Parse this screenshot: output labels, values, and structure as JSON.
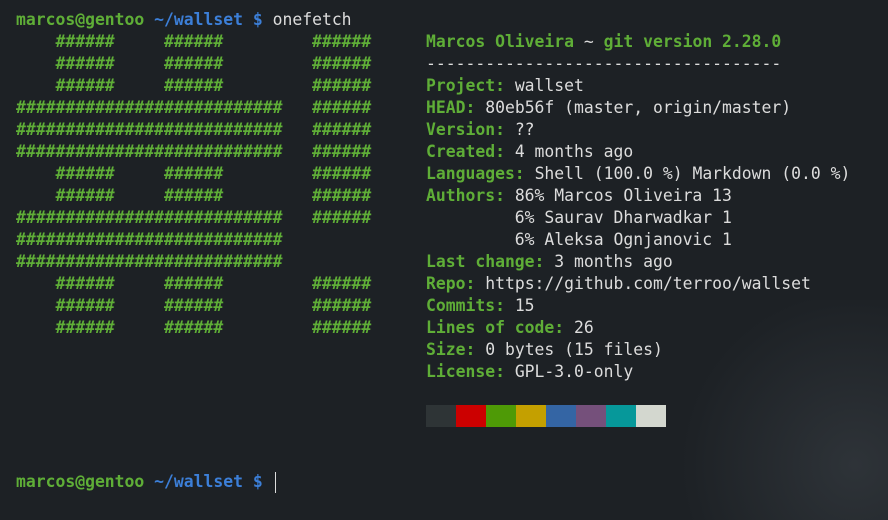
{
  "prompt": {
    "user_host": "marcos@gentoo",
    "path": "~/wallset",
    "symbol": "$"
  },
  "command": "onefetch",
  "ascii_art": [
    "    ######     ######         ######",
    "    ######     ######         ######",
    "    ######     ######         ######",
    "###########################   ######",
    "###########################   ######",
    "###########################   ######",
    "    ######     ######         ######",
    "    ######     ######         ######",
    "###########################   ######",
    "###########################",
    "###########################",
    "    ######     ######         ######",
    "    ######     ######         ######",
    "    ######     ######         ######"
  ],
  "header": {
    "name": "Marcos Oliveira",
    "tilde": " ~ ",
    "git": "git version 2.28.0"
  },
  "separator": "------------------------------------",
  "info": [
    {
      "key": "Project: ",
      "value": "wallset"
    },
    {
      "key": "HEAD: ",
      "value": "80eb56f (master, origin/master)"
    },
    {
      "key": "Version: ",
      "value": "??"
    },
    {
      "key": "Created: ",
      "value": "4 months ago"
    },
    {
      "key": "Languages: ",
      "value": "Shell (100.0 %) Markdown (0.0 %)"
    },
    {
      "key": "Authors: ",
      "value": "86% Marcos Oliveira 13"
    },
    {
      "key": "",
      "value": "         6% Saurav Dharwadkar 1"
    },
    {
      "key": "",
      "value": "         6% Aleksa Ognjanovic 1"
    },
    {
      "key": "Last change: ",
      "value": "3 months ago"
    },
    {
      "key": "Repo: ",
      "value": "https://github.com/terroo/wallset"
    },
    {
      "key": "Commits: ",
      "value": "15"
    },
    {
      "key": "Lines of code: ",
      "value": "26"
    },
    {
      "key": "Size: ",
      "value": "0 bytes (15 files)"
    },
    {
      "key": "License: ",
      "value": "GPL-3.0-only"
    }
  ],
  "palette": [
    "#2e3436",
    "#cc0000",
    "#4e9a06",
    "#c4a000",
    "#3465a4",
    "#75507b",
    "#06989a",
    "#d3d7cf"
  ]
}
